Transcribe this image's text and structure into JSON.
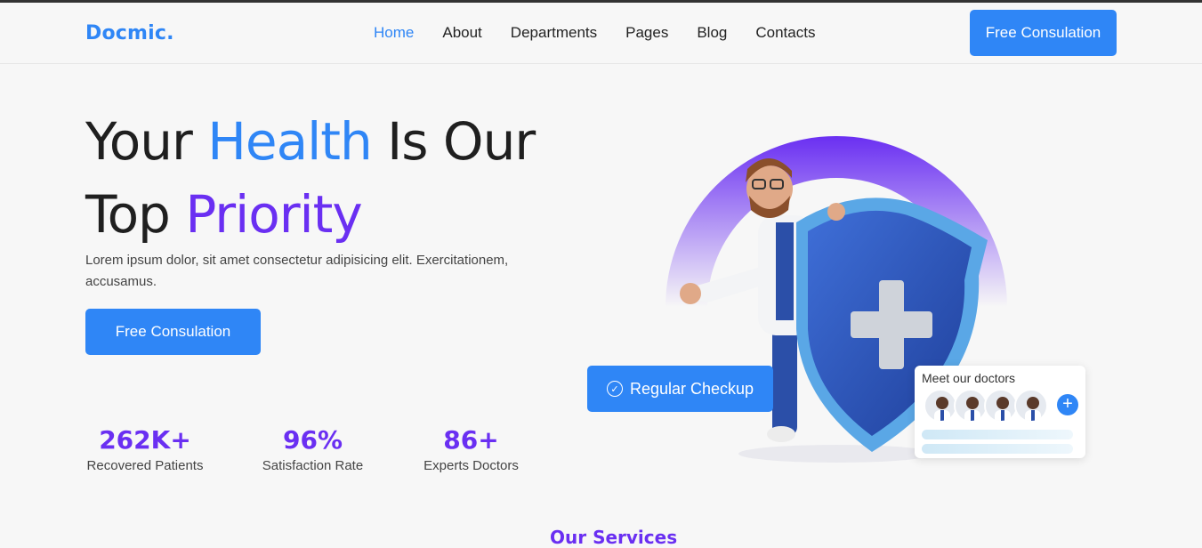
{
  "brand": {
    "logo": "Docmic.",
    "accent": "#2f86f6",
    "secondary": "#6a2ff2"
  },
  "nav": {
    "items": [
      {
        "label": "Home",
        "active": true
      },
      {
        "label": "About",
        "active": false
      },
      {
        "label": "Departments",
        "active": false
      },
      {
        "label": "Pages",
        "active": false
      },
      {
        "label": "Blog",
        "active": false
      },
      {
        "label": "Contacts",
        "active": false
      }
    ],
    "cta_label": "Free Consulation"
  },
  "hero": {
    "title_part1": "Your ",
    "title_hl1": "Health",
    "title_part2": " Is Our",
    "title_part3": "Top ",
    "title_hl2": "Priority",
    "description": "Lorem ipsum dolor, sit amet consectetur adipisicing elit. Exercitationem, accusamus.",
    "cta_label": "Free Consulation"
  },
  "stats": [
    {
      "value": "262K+",
      "label": "Recovered Patients"
    },
    {
      "value": "96%",
      "label": "Satisfaction Rate"
    },
    {
      "value": "86+",
      "label": "Experts Doctors"
    }
  ],
  "illustration": {
    "checkup_label": "Regular Checkup",
    "checkup_icon": "check-circle-icon",
    "doctors_card_title": "Meet our doctors",
    "plus_icon": "plus-icon",
    "plus_glyph": "+"
  },
  "next_section_peek": "Our Services"
}
